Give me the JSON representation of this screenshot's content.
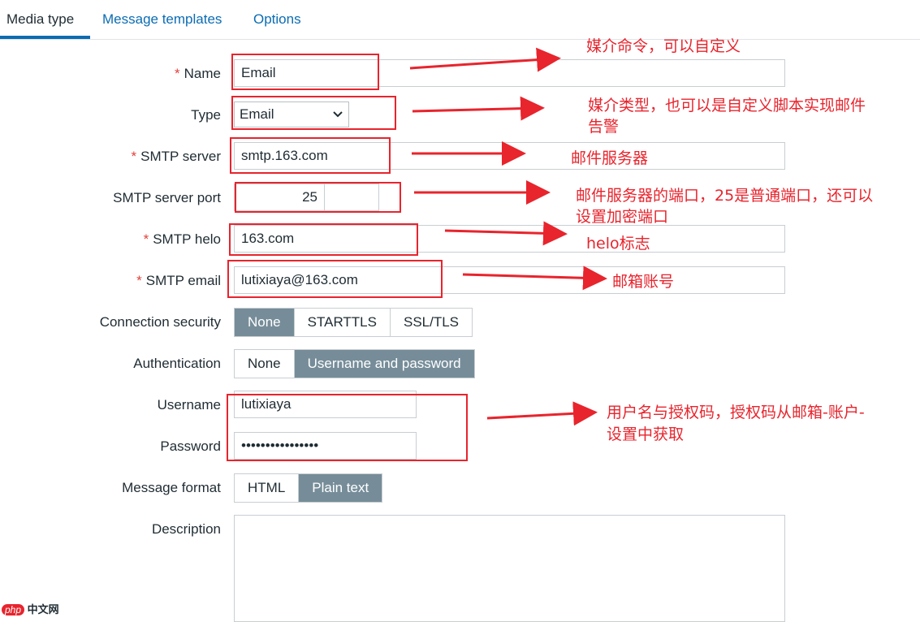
{
  "tabs": [
    {
      "label": "Media type",
      "active": true
    },
    {
      "label": "Message templates",
      "active": false
    },
    {
      "label": "Options",
      "active": false
    }
  ],
  "form": {
    "name": {
      "label": "Name",
      "required": true,
      "value": "Email"
    },
    "type": {
      "label": "Type",
      "required": false,
      "value": "Email"
    },
    "smtp_server": {
      "label": "SMTP server",
      "required": true,
      "value": "smtp.163.com"
    },
    "smtp_port": {
      "label": "SMTP server port",
      "required": false,
      "value": "25"
    },
    "smtp_helo": {
      "label": "SMTP helo",
      "required": true,
      "value": "163.com"
    },
    "smtp_email": {
      "label": "SMTP email",
      "required": true,
      "value": "lutixiaya@163.com"
    },
    "connection_security": {
      "label": "Connection security",
      "options": [
        "None",
        "STARTTLS",
        "SSL/TLS"
      ],
      "selected": "None"
    },
    "authentication": {
      "label": "Authentication",
      "options": [
        "None",
        "Username and password"
      ],
      "selected": "Username and password"
    },
    "username": {
      "label": "Username",
      "value": "lutixiaya"
    },
    "password": {
      "label": "Password",
      "value": "••••••••••••••••"
    },
    "message_format": {
      "label": "Message format",
      "options": [
        "HTML",
        "Plain text"
      ],
      "selected": "Plain text"
    },
    "description": {
      "label": "Description",
      "value": ""
    }
  },
  "annotations": {
    "name": "媒介命令，可以自定义",
    "type_line1": "媒介类型，也可以是自定义脚本实现邮件",
    "type_line2": "告警",
    "smtp_server": "邮件服务器",
    "port_line1": "邮件服务器的端口，25是普通端口，还可以",
    "port_line2": "设置加密端口",
    "helo": "helo标志",
    "email": "邮箱账号",
    "auth_line1": "用户名与授权码，授权码从邮箱-账户-",
    "auth_line2": "设置中获取"
  },
  "watermark": {
    "brand": "php",
    "text": "中文网"
  },
  "colors": {
    "accent": "#0b6cb3",
    "required": "#e3413a",
    "selected_segment": "#768d99",
    "annotation": "#e8242d"
  }
}
